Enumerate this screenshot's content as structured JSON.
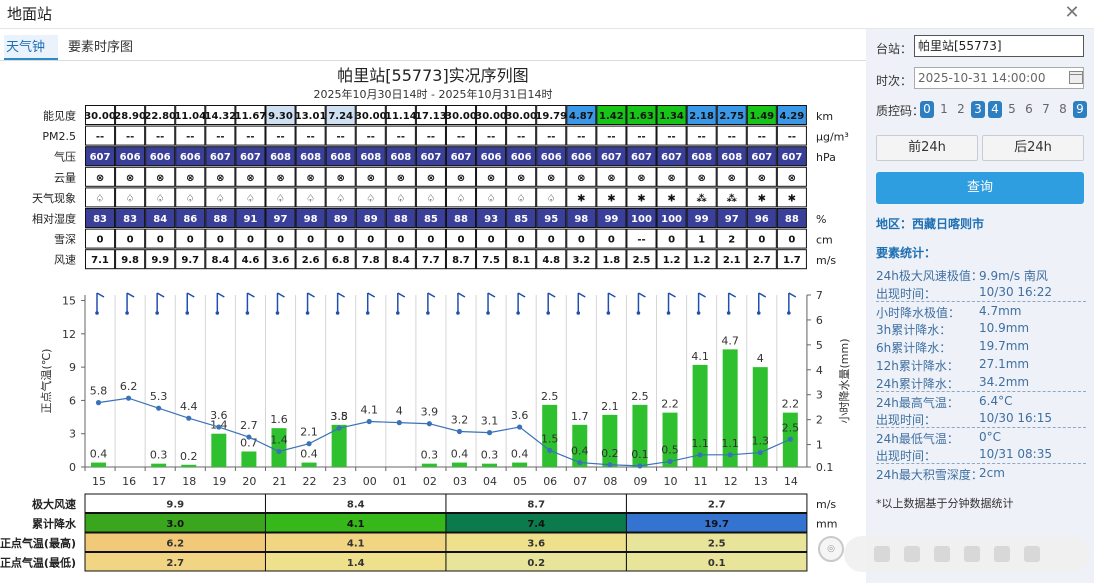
{
  "window": {
    "title": "地面站"
  },
  "tabs": [
    {
      "label": "天气钟"
    },
    {
      "label": "要素时序图"
    }
  ],
  "chart_title": "帕里站[55773]实况序列图",
  "chart_subtitle": "2025年10月30日14时 - 2025年10月31日14时",
  "table": {
    "rows": [
      {
        "label": "能见度",
        "unit": "km",
        "values": [
          "30.00",
          "28.90",
          "22.80",
          "11.04",
          "14.32",
          "11.67",
          "9.30",
          "13.01",
          "7.24",
          "30.00",
          "11.14",
          "17.13",
          "30.00",
          "30.00",
          "30.00",
          "19.79",
          "4.87",
          "1.42",
          "1.63",
          "1.34",
          "2.18",
          "2.75",
          "1.49",
          "4.29"
        ],
        "colors": [
          "#ffffff",
          "#ffffff",
          "#ffffff",
          "#ffffff",
          "#ffffff",
          "#ffffff",
          "#cfe0f3",
          "#ffffff",
          "#cfe0f3",
          "#ffffff",
          "#ffffff",
          "#ffffff",
          "#ffffff",
          "#ffffff",
          "#ffffff",
          "#ffffff",
          "#3b98e6",
          "#19c419",
          "#19c419",
          "#19c419",
          "#3b98e6",
          "#3b98e6",
          "#19c419",
          "#3b98e6"
        ]
      },
      {
        "label": "PM2.5",
        "unit": "μg/m³",
        "values": [
          "--",
          "--",
          "--",
          "--",
          "--",
          "--",
          "--",
          "--",
          "--",
          "--",
          "--",
          "--",
          "--",
          "--",
          "--",
          "--",
          "--",
          "--",
          "--",
          "--",
          "--",
          "--",
          "--",
          "--"
        ]
      },
      {
        "label": "气压",
        "unit": "hPa",
        "values": [
          "607",
          "606",
          "606",
          "606",
          "607",
          "607",
          "608",
          "608",
          "608",
          "608",
          "608",
          "607",
          "607",
          "606",
          "606",
          "606",
          "606",
          "607",
          "607",
          "607",
          "608",
          "608",
          "607",
          "607"
        ]
      },
      {
        "label": "云量",
        "unit": "",
        "values": [
          "⊗",
          "⊗",
          "⊗",
          "⊗",
          "⊗",
          "⊗",
          "⊗",
          "⊗",
          "⊗",
          "⊗",
          "⊗",
          "⊗",
          "⊗",
          "⊗",
          "⊗",
          "⊗",
          "⊗",
          "⊗",
          "⊗",
          "⊗",
          "⊗",
          "⊗",
          "⊗",
          "⊗"
        ]
      },
      {
        "label": "天气现象",
        "unit": "",
        "values": [
          "♤",
          "♤",
          "♤",
          "♤",
          "♤",
          "♤",
          "♤",
          "♤",
          "♤",
          "♤",
          "♤",
          "♤",
          "♤",
          "♤",
          "♤",
          "♤",
          "✱",
          "✱",
          "✱",
          "✱",
          "⁂",
          "⁂",
          "✱",
          "✱"
        ]
      },
      {
        "label": "相对湿度",
        "unit": "%",
        "values": [
          "83",
          "83",
          "84",
          "86",
          "88",
          "91",
          "97",
          "98",
          "89",
          "89",
          "88",
          "85",
          "88",
          "93",
          "85",
          "95",
          "98",
          "99",
          "100",
          "100",
          "99",
          "97",
          "96",
          "88"
        ]
      },
      {
        "label": "雪深",
        "unit": "cm",
        "values": [
          "0",
          "0",
          "0",
          "0",
          "0",
          "0",
          "0",
          "0",
          "0",
          "0",
          "0",
          "0",
          "0",
          "0",
          "0",
          "0",
          "0",
          "0",
          "--",
          "0",
          "1",
          "2",
          "0",
          "0"
        ]
      },
      {
        "label": "风速",
        "unit": "m/s",
        "values": [
          "7.1",
          "9.8",
          "9.9",
          "9.7",
          "8.4",
          "4.6",
          "3.6",
          "2.6",
          "6.8",
          "7.8",
          "8.4",
          "7.7",
          "8.7",
          "7.5",
          "8.1",
          "4.8",
          "3.2",
          "1.8",
          "2.5",
          "1.2",
          "1.2",
          "2.1",
          "2.7",
          "1.7"
        ]
      }
    ]
  },
  "chart_data": {
    "type": "bar",
    "categories": [
      "15",
      "16",
      "17",
      "18",
      "19",
      "20",
      "21",
      "22",
      "23",
      "00",
      "01",
      "02",
      "03",
      "04",
      "05",
      "06",
      "07",
      "08",
      "09",
      "10",
      "11",
      "12",
      "13",
      "14"
    ],
    "ylabel": "正点气温(℃)",
    "ylabel_right": "小时降水量(mm)",
    "yticks_left": [
      "0",
      "3",
      "6",
      "9",
      "12",
      "15"
    ],
    "yticks_right": [
      "0.1",
      "1",
      "2",
      "3",
      "4",
      "5",
      "6",
      "7"
    ],
    "ylim": [
      0,
      15.5
    ],
    "ylim_right": [
      0.1,
      7
    ],
    "series": [
      {
        "values": [
          0.4,
          0.0,
          0.3,
          0.2,
          3.0,
          1.4,
          3.5,
          0.4,
          3.8,
          0.0,
          0.0,
          0.3,
          0.4,
          0.3,
          0.4,
          5.6,
          3.8,
          4.7,
          5.6,
          4.9,
          9.2,
          10.6,
          9.0,
          4.9
        ],
        "labels": [
          "0.4",
          "",
          "0.3",
          "0.2",
          "1.4",
          "0.7",
          "1.6",
          "0.4",
          "3.5",
          "",
          "",
          "0.3",
          "0.4",
          "0.3",
          "0.4",
          "2.5",
          "1.7",
          "2.1",
          "2.5",
          "2.2",
          "4.1",
          "4.7",
          "4",
          "2.2"
        ],
        "color": "#2fc02f"
      },
      {
        "values": [
          5.8,
          6.2,
          5.3,
          4.4,
          3.6,
          2.7,
          1.4,
          2.1,
          3.5,
          4.1,
          4.0,
          3.9,
          3.2,
          3.1,
          3.6,
          1.5,
          0.4,
          0.2,
          0.1,
          0.5,
          1.1,
          1.1,
          1.3,
          2.5
        ],
        "labels": [
          "5.8",
          "6.2",
          "5.3",
          "4.4",
          "3.6",
          "2.7",
          "1.4",
          "2.1",
          "3.8",
          "4.1",
          "4",
          "3.9",
          "3.2",
          "3.1",
          "3.6",
          "1.5",
          "0.4",
          "0.2",
          "0.1",
          "0.5",
          "1.1",
          "1.1",
          "1.3",
          "2.5"
        ],
        "color": "#3a72b8"
      }
    ]
  },
  "summary": {
    "rows": [
      {
        "label": "极大风速",
        "unit": "m/s",
        "values": [
          "9.9",
          "8.4",
          "8.7",
          "2.7"
        ],
        "colors": [
          "#ffffff",
          "#ffffff",
          "#ffffff",
          "#ffffff"
        ]
      },
      {
        "label": "累计降水",
        "unit": "mm",
        "values": [
          "3.0",
          "4.1",
          "7.4",
          "19.7"
        ],
        "colors": [
          "#3aa61e",
          "#37b81a",
          "#0b7a4c",
          "#3473cf"
        ]
      },
      {
        "label": "正点气温(最高)",
        "unit": "",
        "values": [
          "6.2",
          "4.1",
          "3.6",
          "2.5"
        ],
        "colors": [
          "#f2c879",
          "#f2d582",
          "#efe08c",
          "#e8e59a"
        ]
      },
      {
        "label": "正点气温(最低)",
        "unit": "",
        "values": [
          "2.7",
          "1.4",
          "0.2",
          "0.1"
        ],
        "colors": [
          "#f2d582",
          "#efe08c",
          "#e8e59a",
          "#e8e59a"
        ]
      }
    ]
  },
  "panel": {
    "station_label": "台站：",
    "station_value": "帕里站[55773]",
    "time_label": "时次：",
    "time_value": "2025-10-31 14:00:00",
    "qc_label": "质控码：",
    "qc_codes": [
      {
        "label": "0",
        "on": true
      },
      {
        "label": "1",
        "on": false
      },
      {
        "label": "2",
        "on": false
      },
      {
        "label": "3",
        "on": true
      },
      {
        "label": "4",
        "on": true
      },
      {
        "label": "5",
        "on": false
      },
      {
        "label": "6",
        "on": false
      },
      {
        "label": "7",
        "on": false
      },
      {
        "label": "8",
        "on": false
      },
      {
        "label": "9",
        "on": true
      }
    ],
    "prev_label": "前24h",
    "next_label": "后24h",
    "query_label": "查询",
    "region": "地区：西藏日喀则市",
    "stats_title": "要素统计：",
    "stats": [
      {
        "k": "24h极大风速极值：",
        "v": "9.9m/s 南风",
        "dash": false
      },
      {
        "k": "出现时间：",
        "v": "10/30 16:22",
        "dash": false
      },
      {
        "k": "小时降水极值：",
        "v": "4.7mm",
        "dash": true
      },
      {
        "k": "3h累计降水：",
        "v": "10.9mm",
        "dash": false
      },
      {
        "k": "6h累计降水：",
        "v": "19.7mm",
        "dash": false
      },
      {
        "k": "12h累计降水：",
        "v": "27.1mm",
        "dash": false
      },
      {
        "k": "24h累计降水：",
        "v": "34.2mm",
        "dash": false
      },
      {
        "k": "24h最高气温：",
        "v": "6.4°C",
        "dash": true
      },
      {
        "k": "出现时间：",
        "v": "10/30 16:15",
        "dash": false
      },
      {
        "k": "24h最低气温：",
        "v": "0°C",
        "dash": true
      },
      {
        "k": "出现时间：",
        "v": "10/31 08:35",
        "dash": false
      },
      {
        "k": "24h最大积雪深度：",
        "v": "2cm",
        "dash": true
      }
    ],
    "footnote": "*以上数据基于分钟数据统计"
  },
  "colors": {
    "accent": "#2e9ee0",
    "pressure_bg": "#3a3f99",
    "humidity_bg": "#3a3f99"
  }
}
